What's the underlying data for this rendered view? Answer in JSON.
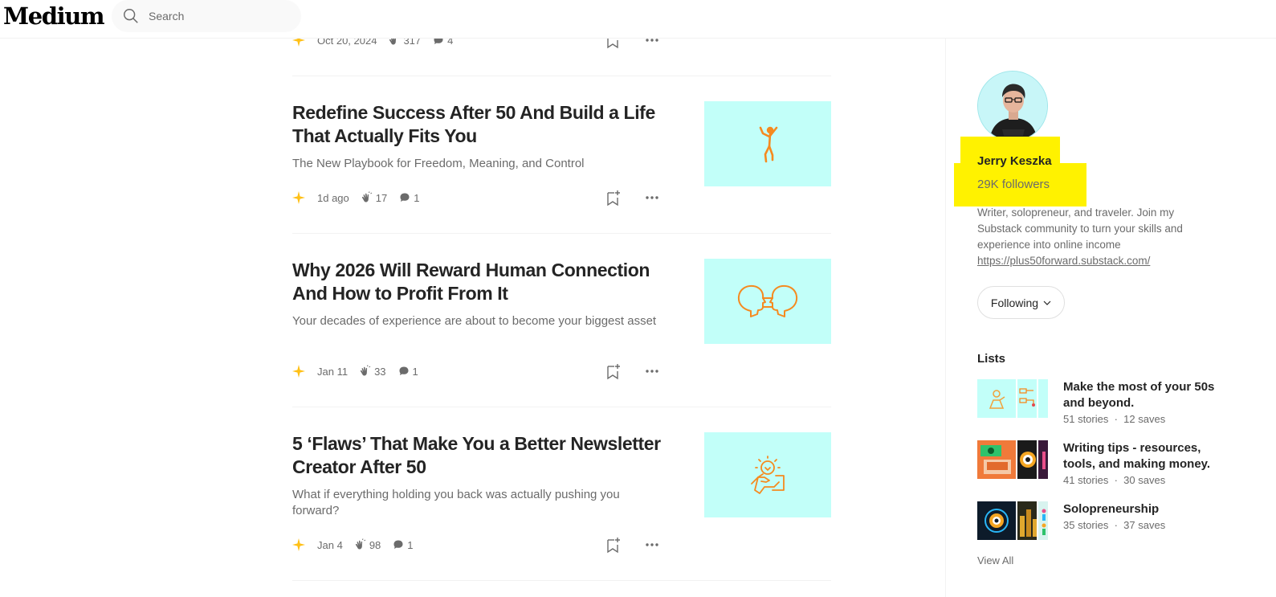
{
  "header": {
    "logo": "Medium",
    "search_placeholder": "Search"
  },
  "articles": [
    {
      "title": "",
      "subtitle": "",
      "date": "Oct 20, 2024",
      "claps": "317",
      "comments": "4"
    },
    {
      "title": "Redefine Success After 50 And Build a Life That Actually Fits You",
      "subtitle": "The New Playbook for Freedom, Meaning, and Control",
      "date": "1d ago",
      "claps": "17",
      "comments": "1",
      "thumbnail_icon": "person-jumping-icon"
    },
    {
      "title": "Why 2026 Will Reward Human Connection And How to Profit From It",
      "subtitle": "Your decades of experience are about to become your biggest asset",
      "date": "Jan 11",
      "claps": "33",
      "comments": "1",
      "thumbnail_icon": "two-heads-connection-icon"
    },
    {
      "title": "5 ‘Flaws’ That Make You a Better Newsletter Creator After 50",
      "subtitle": "What if everything holding you back was actually pushing you forward?",
      "date": "Jan 4",
      "claps": "98",
      "comments": "1",
      "thumbnail_icon": "hand-holding-lightbulb-icon"
    }
  ],
  "author": {
    "name": "Jerry Keszka",
    "followers": "29K followers",
    "bio": "Writer, solopreneur, and traveler. Join my Substack community to turn your skills and experience into online income",
    "link": "https://plus50forward.substack.com/",
    "follow_label": "Following"
  },
  "lists": {
    "heading": "Lists",
    "items": [
      {
        "title": "Make the most of your 50s and beyond.",
        "stories": "51 stories",
        "saves": "12 saves"
      },
      {
        "title": "Writing tips - resources, tools, and making money.",
        "stories": "41 stories",
        "saves": "30 saves"
      },
      {
        "title": "Solopreneurship",
        "stories": "35 stories",
        "saves": "37 saves"
      }
    ],
    "view_all": "View All"
  },
  "colors": {
    "accent_star": "#ffc017",
    "thumbnail_bg": "#c2fff9",
    "icon_orange": "#f58a1f",
    "highlight": "#fff200"
  }
}
